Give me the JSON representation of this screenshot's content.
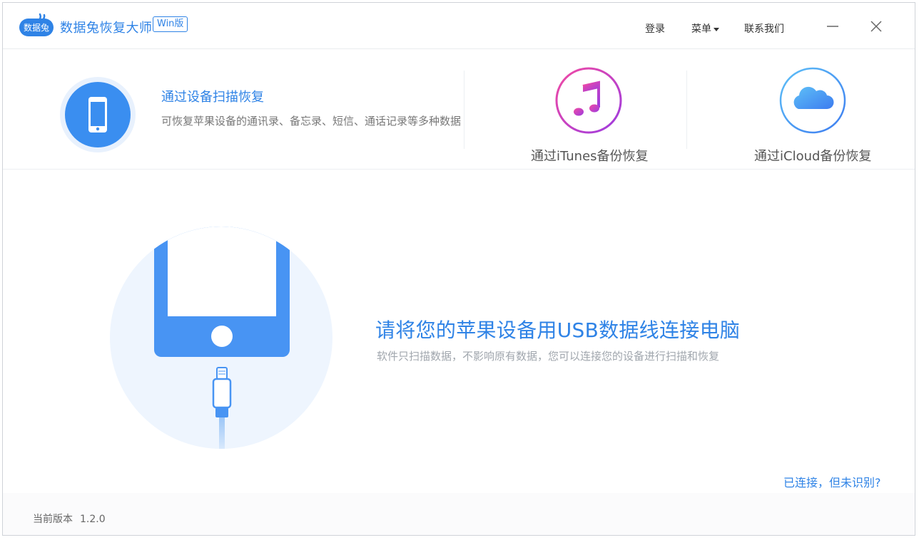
{
  "app": {
    "logo_text": "数据兔",
    "title": "数据兔恢复大师",
    "edition": "Win版"
  },
  "nav": {
    "login": "登录",
    "menu": "菜单",
    "contact": "联系我们"
  },
  "modes": {
    "scan": {
      "title": "通过设备扫描恢复",
      "description": "可恢复苹果设备的通讯录、备忘录、短信、通话记录等多种数据"
    },
    "itunes": {
      "label": "通过iTunes备份恢复"
    },
    "icloud": {
      "label": "通过iCloud备份恢复"
    }
  },
  "main": {
    "headline": "请将您的苹果设备用USB数据线连接电脑",
    "subtext": "软件只扫描数据，不影响原有数据，您可以连接您的设备进行扫描和恢复",
    "help_link": "已连接，但未识别?"
  },
  "footer": {
    "version_label": "当前版本",
    "version": "1.2.0"
  },
  "colors": {
    "accent": "#2f83e6",
    "itunes_gradient": [
      "#f24aa3",
      "#9c3be0"
    ],
    "icloud_gradient": [
      "#5ec0f7",
      "#3d7cf0"
    ]
  }
}
